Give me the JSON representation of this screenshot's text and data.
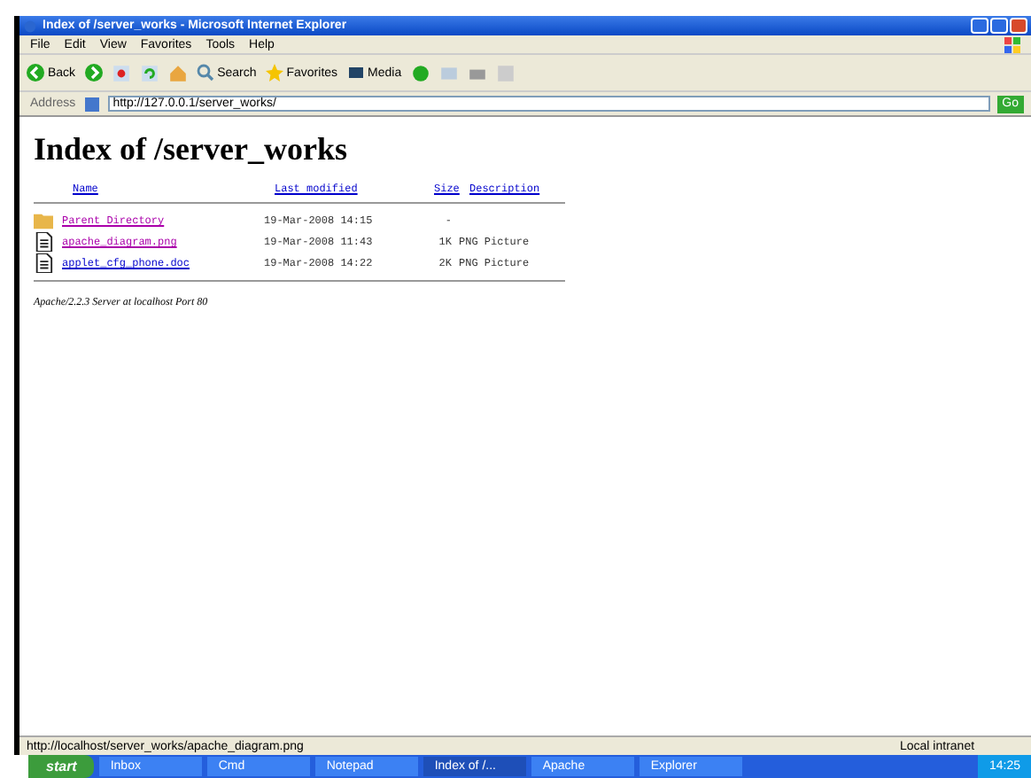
{
  "window": {
    "title": "Index of /server_works - Microsoft Internet Explorer"
  },
  "menu": [
    "File",
    "Edit",
    "View",
    "Favorites",
    "Tools",
    "Help"
  ],
  "toolbar": {
    "back": "Back",
    "search": "Search",
    "favorites": "Favorites",
    "media": "Media"
  },
  "address": {
    "label": "Address",
    "value": "http://127.0.0.1/server_works/",
    "go": "Go"
  },
  "page": {
    "heading": "Index of /server_works",
    "columns": [
      "Name",
      "Last modified",
      "Size",
      "Description"
    ],
    "rows": [
      {
        "kind": "folder",
        "name": "Parent Directory",
        "visited": true,
        "modified": "19-Mar-2008 14:15",
        "size": "-",
        "description": ""
      },
      {
        "kind": "file",
        "name": "apache_diagram.png",
        "visited": true,
        "modified": "19-Mar-2008 11:43",
        "size": "1K",
        "description": "PNG Picture"
      },
      {
        "kind": "file",
        "name": "applet_cfg_phone.doc",
        "visited": false,
        "modified": "19-Mar-2008 14:22",
        "size": "2K",
        "description": "PNG Picture"
      }
    ],
    "footer": "Apache/2.2.3 Server at localhost Port 80"
  },
  "status_bar": {
    "text": "http://localhost/server_works/apache_diagram.png",
    "zone": "Local intranet"
  },
  "taskbar": {
    "start": "start",
    "tasks": [
      {
        "label": "Inbox",
        "selected": false
      },
      {
        "label": "Cmd",
        "selected": false
      },
      {
        "label": "Notepad",
        "selected": false
      },
      {
        "label": "Index of /...",
        "selected": true
      },
      {
        "label": "Apache",
        "selected": false
      },
      {
        "label": "Explorer",
        "selected": false
      }
    ],
    "clock": "14:25"
  }
}
